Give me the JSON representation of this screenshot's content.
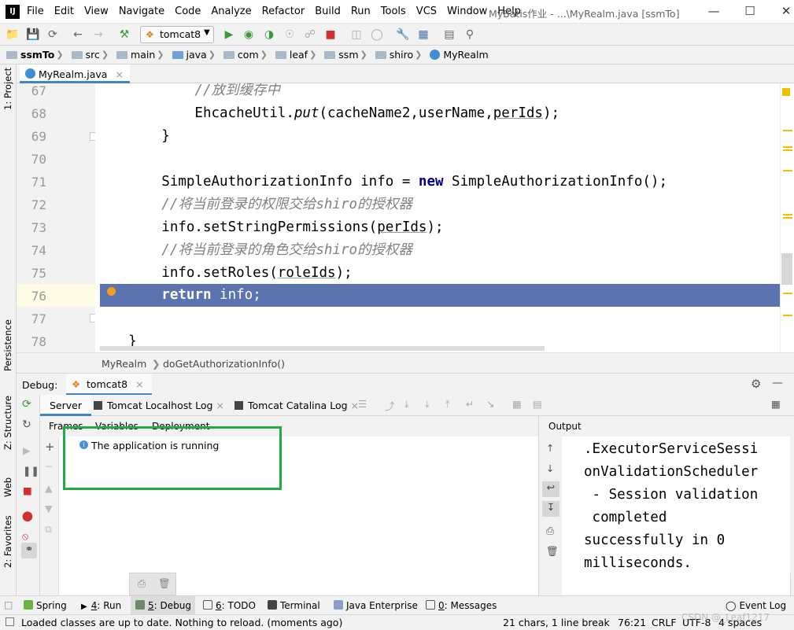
{
  "window": {
    "title": "MyBatis作业 - ...\\MyRealm.java [ssmTo]",
    "logo": "IJ"
  },
  "menu": [
    "File",
    "Edit",
    "View",
    "Navigate",
    "Code",
    "Analyze",
    "Refactor",
    "Build",
    "Run",
    "Tools",
    "VCS",
    "Window",
    "Help"
  ],
  "toolbar": {
    "run_config": "tomcat8"
  },
  "breadcrumbs": [
    "ssmTo",
    "src",
    "main",
    "java",
    "com",
    "leaf",
    "ssm",
    "shiro",
    "MyRealm"
  ],
  "editor": {
    "tab": "MyRealm.java",
    "lines": [
      {
        "n": "67",
        "t": "            //放到缓存中"
      },
      {
        "n": "68",
        "t": "            EhcacheUtil.put(cacheName2,userName,perIds);"
      },
      {
        "n": "69",
        "t": "        }"
      },
      {
        "n": "70",
        "t": ""
      },
      {
        "n": "71",
        "t": "        SimpleAuthorizationInfo info = new SimpleAuthorizationInfo();"
      },
      {
        "n": "72",
        "t": "        //将当前登录的权限交给shiro的授权器"
      },
      {
        "n": "73",
        "t": "        info.setStringPermissions(perIds);"
      },
      {
        "n": "74",
        "t": "        //将当前登录的角色交给shiro的授权器"
      },
      {
        "n": "75",
        "t": "        info.setRoles(roleIds);"
      },
      {
        "n": "76",
        "t": "        return info;"
      },
      {
        "n": "77",
        "t": "    }"
      },
      {
        "n": "78",
        "t": ""
      }
    ],
    "breadcrumb": [
      "MyRealm",
      "doGetAuthorizationInfo()"
    ]
  },
  "side_labels": [
    "1: Project",
    "Persistence",
    "Z: Structure",
    "Web",
    "2: Favorites"
  ],
  "debug": {
    "label": "Debug:",
    "session": "tomcat8",
    "tabs": [
      "Server",
      "Tomcat Localhost Log",
      "Tomcat Catalina Log"
    ],
    "subtabs": [
      "Frames",
      "Variables",
      "Deployment"
    ],
    "message": "The application is running",
    "output_label": "Output",
    "output_lines": [
      ".ExecutorServiceSessi",
      "onValidationScheduler",
      " - Session validation",
      " completed",
      "successfully in 0",
      "milliseconds."
    ]
  },
  "bottom_tabs": [
    {
      "k": "",
      "label": "Spring"
    },
    {
      "k": "4",
      "label": ": Run"
    },
    {
      "k": "5",
      "label": ": Debug"
    },
    {
      "k": "6",
      "label": ": TODO"
    },
    {
      "k": "",
      "label": "Terminal"
    },
    {
      "k": "",
      "label": "Java Enterprise"
    },
    {
      "k": "0",
      "label": ": Messages"
    },
    {
      "k": "",
      "label": "Event Log"
    }
  ],
  "status": {
    "message": "Loaded classes are up to date. Nothing to reload. (moments ago)",
    "selection": "21 chars, 1 line break",
    "position": "76:21",
    "line_sep": "CRLF",
    "encoding": "UTF-8",
    "indent": "4 spaces",
    "watermark": "CSDN @_Leaf1217"
  },
  "colors": {
    "highlight": "#5b74af",
    "annotation_box": "#22aa44",
    "accent": "#4083c9"
  }
}
